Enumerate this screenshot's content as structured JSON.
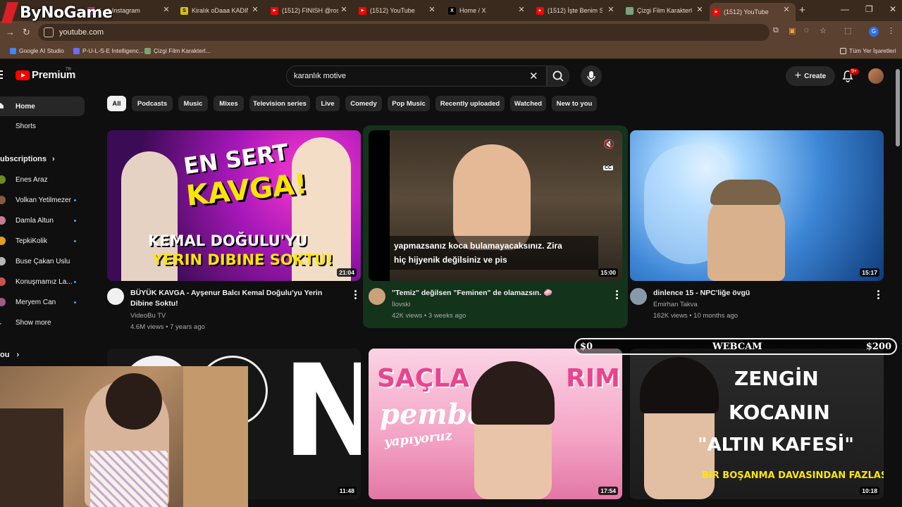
{
  "overlay": {
    "logo_text": "ByNoGame"
  },
  "browser": {
    "tabs": [
      {
        "title": "(..+) Instagram",
        "favicon_color": "#c13584",
        "favicon_glyph": ""
      },
      {
        "title": "Kiralık oDaaa KADINI",
        "favicon_color": "#d4c016",
        "favicon_glyph": "S"
      },
      {
        "title": "(1512) FINISH @rosel",
        "favicon_color": "#ff0000",
        "favicon_glyph": "▶"
      },
      {
        "title": "(1512) YouTube",
        "favicon_color": "#ff0000",
        "favicon_glyph": "▶"
      },
      {
        "title": "Home / X",
        "favicon_color": "#000000",
        "favicon_glyph": "X"
      },
      {
        "title": "(1512) İşte Benim Stil",
        "favicon_color": "#ff0000",
        "favicon_glyph": "▶"
      },
      {
        "title": "Çizgi Film Karakterler",
        "favicon_color": "#7aa37a",
        "favicon_glyph": ""
      },
      {
        "title": "(1512) YouTube",
        "favicon_color": "#ff0000",
        "favicon_glyph": "▶"
      }
    ],
    "active_tab_index": 7,
    "url": "youtube.com",
    "profile_initial": "G",
    "bookmarks": [
      {
        "label": "Google AI Studio",
        "color": "#4285f4"
      },
      {
        "label": "P-U-L-S-E Intelligenc...",
        "color": "#6c6cff"
      },
      {
        "label": "Çizgi Film Karakterl...",
        "color": "#7aa37a"
      }
    ],
    "all_bookmarks": "Tüm Yer İşaretleri"
  },
  "masthead": {
    "logo": "Premium",
    "region": "TR",
    "search_query": "karanlık motive",
    "create_label": "Create",
    "notification_badge": "9+"
  },
  "sidebar": {
    "nav": [
      {
        "label": "Home"
      },
      {
        "label": "Shorts"
      }
    ],
    "subscriptions_heading": "ubscriptions",
    "subscriptions": [
      {
        "name": "Enes Araz",
        "color": "#6b8e23",
        "live": false
      },
      {
        "name": "Volkan Yetilmezer",
        "color": "#8b5a3c",
        "live": true
      },
      {
        "name": "Damla Altun",
        "color": "#c47a9a",
        "live": true
      },
      {
        "name": "TepkiKolik",
        "color": "#e0a020",
        "live": true
      },
      {
        "name": "Buse Çakan Uslu",
        "color": "#b7b7b7",
        "live": false
      },
      {
        "name": "Konuşmamız La...",
        "color": "#d05050",
        "live": true
      },
      {
        "name": "Meryem Can",
        "color": "#a05a8a",
        "live": true
      }
    ],
    "show_more": "Show more",
    "you_heading": "ou"
  },
  "chips": [
    "All",
    "Podcasts",
    "Music",
    "Mixes",
    "Television series",
    "Live",
    "Comedy",
    "Pop Music",
    "Recently uploaded",
    "Watched",
    "New to you"
  ],
  "videos": [
    {
      "title": "BÜYÜK KAVGA - Ayşenur Balcı Kemal Doğulu'yu Yerin Dibine Soktu!",
      "channel": "VideoBu TV",
      "meta": "4.6M views • 7 years ago",
      "duration": "21:04",
      "thumb_text": [
        "EN SERT",
        "KAVGA!",
        "KEMAL DOĞULU'YU",
        "YERIN DIBINE SOKTU!"
      ],
      "avatar_color": "#f1f1f1"
    },
    {
      "title": "\"Temiz\" değilsen \"Feminen\" de olamazsın. 🧼",
      "channel": "İlovski",
      "meta": "42K views • 3 weeks ago",
      "duration": "15:00",
      "caption_lines": [
        "yapmazsanız koca bulamayacaksınız. Zira",
        "hiç hijyenik değilsiniz ve pis"
      ],
      "cc_label": "CC",
      "avatar_color": "#c9a27a"
    },
    {
      "title": "dinlence 15 - NPC'liğe övgü",
      "channel": "Emirhan Takva",
      "meta": "162K views • 10 months ago",
      "duration": "15:17",
      "avatar_color": "#8899aa"
    },
    {
      "duration": "11:48",
      "thumb_text": [
        "N"
      ]
    },
    {
      "duration": "17:54",
      "thumb_text": [
        "SAÇLA",
        "RIMI",
        "pembe",
        "yapıyoruz"
      ]
    },
    {
      "duration": "10:18",
      "thumb_text": [
        "ZENGİN",
        "KOCANIN",
        "\"ALTIN KAFESİ\"",
        "BİR BOŞANMA DAVASINDAN FAZLASI"
      ]
    }
  ],
  "webcam_bar": {
    "left": "$0",
    "center": "WEBCAM",
    "right": "$200"
  },
  "colors": {
    "accent": "#ff0000",
    "hover_card": "#13331b",
    "chrome": "#5b4130"
  }
}
